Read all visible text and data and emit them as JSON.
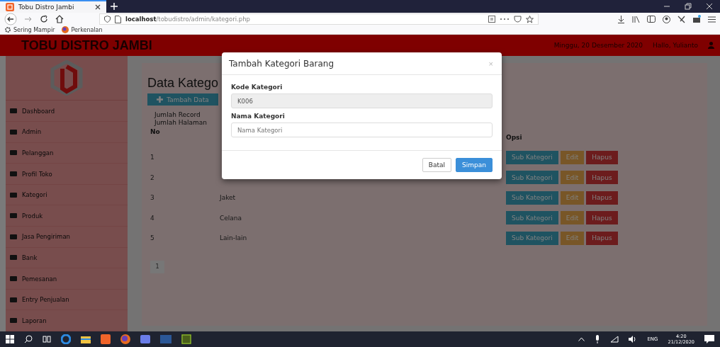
{
  "browser": {
    "tab_title": "Tobu Distro Jambi",
    "url_host": "localhost",
    "url_path": "/tobudistro/admin/kategori.php",
    "bookmarks": [
      "Sering Mampir",
      "Perkenalan"
    ]
  },
  "header": {
    "brand": "TOBU DISTRO JAMBI",
    "date": "Minggu, 20 Desember 2020",
    "greeting": "Hallo, Yulianto"
  },
  "sidebar": {
    "items": [
      "Dashboard",
      "Admin",
      "Pelanggan",
      "Profil Toko",
      "Kategori",
      "Produk",
      "Jasa Pengiriman",
      "Bank",
      "Pemesanan",
      "Entry Penjualan",
      "Laporan"
    ]
  },
  "page": {
    "title": "Data Katego",
    "add_button": "Tambah Data",
    "record_labels": [
      "Jumlah Record",
      "Jumlah Halaman"
    ]
  },
  "table": {
    "no_header": "No",
    "options_header": "Opsi",
    "rows": [
      {
        "no": "1",
        "actions": [
          {
            "label": "Sub Kategori",
            "kind": "info"
          },
          {
            "label": "Edit",
            "kind": "warning"
          },
          {
            "label": "Hapus",
            "kind": "danger"
          }
        ]
      },
      {
        "no": "2",
        "actions": [
          {
            "label": "Sub Kategori",
            "kind": "info"
          },
          {
            "label": "Edit",
            "kind": "warning"
          },
          {
            "label": "Hapus",
            "kind": "danger"
          }
        ]
      },
      {
        "no": "3",
        "name": "Jaket",
        "actions": [
          {
            "label": "Sub Kategori",
            "kind": "info"
          },
          {
            "label": "Edit",
            "kind": "warning"
          },
          {
            "label": "Hapus",
            "kind": "danger"
          }
        ]
      },
      {
        "no": "4",
        "name": "Celana",
        "actions": [
          {
            "label": "Sub Kategori",
            "kind": "info"
          },
          {
            "label": "Edit",
            "kind": "warning"
          },
          {
            "label": "Hapus",
            "kind": "danger"
          }
        ]
      },
      {
        "no": "5",
        "name": "Lain-lain",
        "actions": [
          {
            "label": "Sub Kategori",
            "kind": "info"
          },
          {
            "label": "Edit",
            "kind": "warning"
          },
          {
            "label": "Hapus",
            "kind": "danger"
          }
        ]
      }
    ]
  },
  "pagination": [
    "1"
  ],
  "modal": {
    "title": "Tambah Kategori Barang",
    "close": "×",
    "fields": [
      {
        "label": "Kode Kategori",
        "value": "K006",
        "disabled": true
      },
      {
        "label": "Nama Kategori",
        "placeholder": "Nama Kategori",
        "disabled": false
      }
    ],
    "buttons": [
      {
        "label": "Batal",
        "kind": "default"
      },
      {
        "label": "Simpan",
        "kind": "primary"
      }
    ]
  },
  "taskbar": {
    "language": "ENG",
    "time": "4:20",
    "date": "21/12/2020"
  }
}
